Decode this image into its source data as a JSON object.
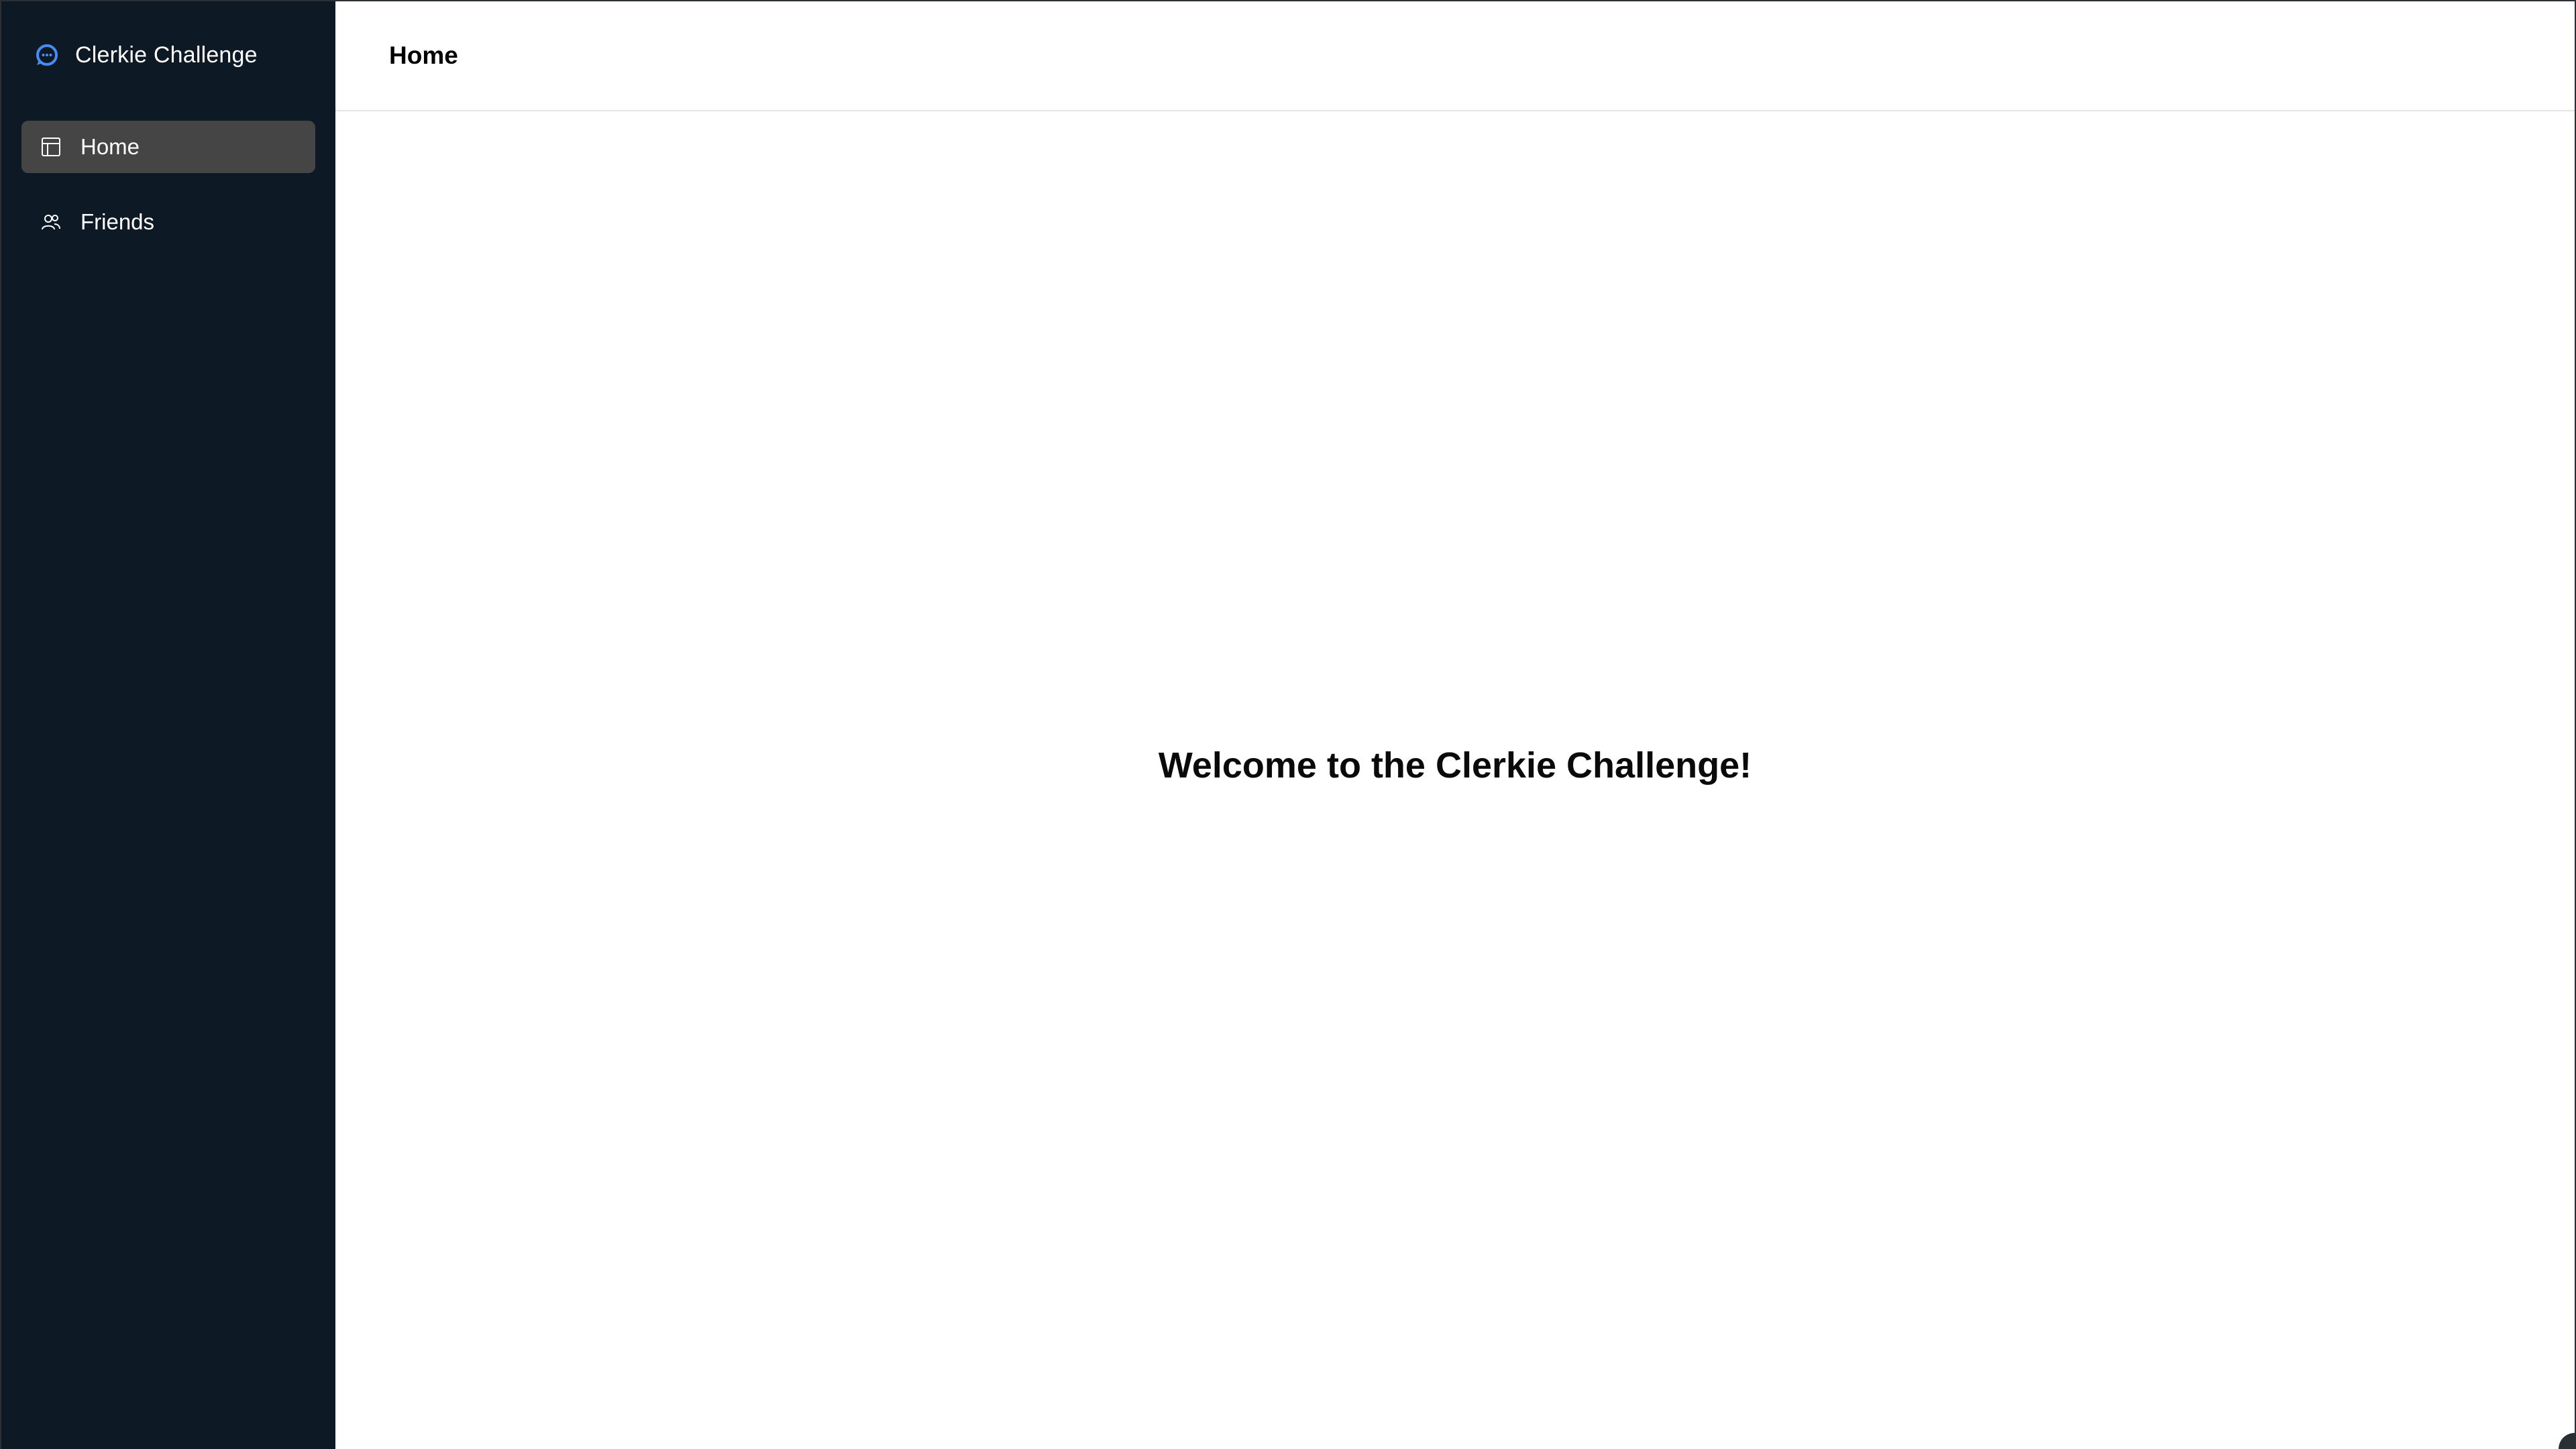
{
  "app": {
    "title": "Clerkie Challenge"
  },
  "sidebar": {
    "items": [
      {
        "label": "Home",
        "icon": "layout-icon",
        "active": true
      },
      {
        "label": "Friends",
        "icon": "users-icon",
        "active": false
      }
    ]
  },
  "header": {
    "title": "Home"
  },
  "main": {
    "welcome": "Welcome to the Clerkie Challenge!"
  },
  "colors": {
    "sidebar_bg": "#0d1a25",
    "active_item_bg": "#454545",
    "brand_accent": "#4a8cf7",
    "text_dark": "#000000"
  }
}
